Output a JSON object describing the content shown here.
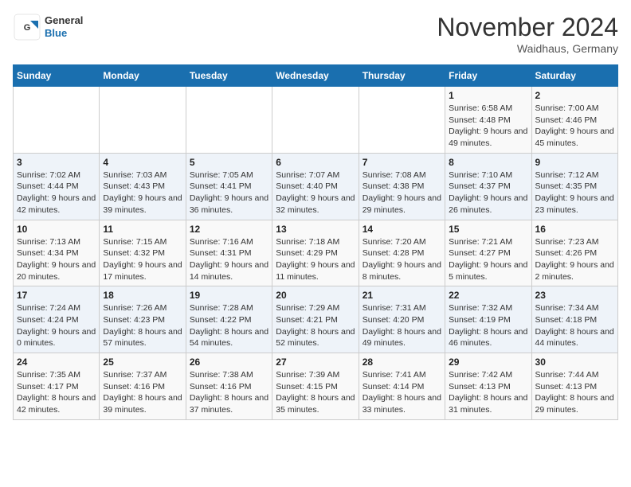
{
  "logo": {
    "text_general": "General",
    "text_blue": "Blue"
  },
  "header": {
    "month_title": "November 2024",
    "location": "Waidhaus, Germany"
  },
  "weekdays": [
    "Sunday",
    "Monday",
    "Tuesday",
    "Wednesday",
    "Thursday",
    "Friday",
    "Saturday"
  ],
  "weeks": [
    [
      {
        "day": "",
        "info": ""
      },
      {
        "day": "",
        "info": ""
      },
      {
        "day": "",
        "info": ""
      },
      {
        "day": "",
        "info": ""
      },
      {
        "day": "",
        "info": ""
      },
      {
        "day": "1",
        "info": "Sunrise: 6:58 AM\nSunset: 4:48 PM\nDaylight: 9 hours and 49 minutes."
      },
      {
        "day": "2",
        "info": "Sunrise: 7:00 AM\nSunset: 4:46 PM\nDaylight: 9 hours and 45 minutes."
      }
    ],
    [
      {
        "day": "3",
        "info": "Sunrise: 7:02 AM\nSunset: 4:44 PM\nDaylight: 9 hours and 42 minutes."
      },
      {
        "day": "4",
        "info": "Sunrise: 7:03 AM\nSunset: 4:43 PM\nDaylight: 9 hours and 39 minutes."
      },
      {
        "day": "5",
        "info": "Sunrise: 7:05 AM\nSunset: 4:41 PM\nDaylight: 9 hours and 36 minutes."
      },
      {
        "day": "6",
        "info": "Sunrise: 7:07 AM\nSunset: 4:40 PM\nDaylight: 9 hours and 32 minutes."
      },
      {
        "day": "7",
        "info": "Sunrise: 7:08 AM\nSunset: 4:38 PM\nDaylight: 9 hours and 29 minutes."
      },
      {
        "day": "8",
        "info": "Sunrise: 7:10 AM\nSunset: 4:37 PM\nDaylight: 9 hours and 26 minutes."
      },
      {
        "day": "9",
        "info": "Sunrise: 7:12 AM\nSunset: 4:35 PM\nDaylight: 9 hours and 23 minutes."
      }
    ],
    [
      {
        "day": "10",
        "info": "Sunrise: 7:13 AM\nSunset: 4:34 PM\nDaylight: 9 hours and 20 minutes."
      },
      {
        "day": "11",
        "info": "Sunrise: 7:15 AM\nSunset: 4:32 PM\nDaylight: 9 hours and 17 minutes."
      },
      {
        "day": "12",
        "info": "Sunrise: 7:16 AM\nSunset: 4:31 PM\nDaylight: 9 hours and 14 minutes."
      },
      {
        "day": "13",
        "info": "Sunrise: 7:18 AM\nSunset: 4:29 PM\nDaylight: 9 hours and 11 minutes."
      },
      {
        "day": "14",
        "info": "Sunrise: 7:20 AM\nSunset: 4:28 PM\nDaylight: 9 hours and 8 minutes."
      },
      {
        "day": "15",
        "info": "Sunrise: 7:21 AM\nSunset: 4:27 PM\nDaylight: 9 hours and 5 minutes."
      },
      {
        "day": "16",
        "info": "Sunrise: 7:23 AM\nSunset: 4:26 PM\nDaylight: 9 hours and 2 minutes."
      }
    ],
    [
      {
        "day": "17",
        "info": "Sunrise: 7:24 AM\nSunset: 4:24 PM\nDaylight: 9 hours and 0 minutes."
      },
      {
        "day": "18",
        "info": "Sunrise: 7:26 AM\nSunset: 4:23 PM\nDaylight: 8 hours and 57 minutes."
      },
      {
        "day": "19",
        "info": "Sunrise: 7:28 AM\nSunset: 4:22 PM\nDaylight: 8 hours and 54 minutes."
      },
      {
        "day": "20",
        "info": "Sunrise: 7:29 AM\nSunset: 4:21 PM\nDaylight: 8 hours and 52 minutes."
      },
      {
        "day": "21",
        "info": "Sunrise: 7:31 AM\nSunset: 4:20 PM\nDaylight: 8 hours and 49 minutes."
      },
      {
        "day": "22",
        "info": "Sunrise: 7:32 AM\nSunset: 4:19 PM\nDaylight: 8 hours and 46 minutes."
      },
      {
        "day": "23",
        "info": "Sunrise: 7:34 AM\nSunset: 4:18 PM\nDaylight: 8 hours and 44 minutes."
      }
    ],
    [
      {
        "day": "24",
        "info": "Sunrise: 7:35 AM\nSunset: 4:17 PM\nDaylight: 8 hours and 42 minutes."
      },
      {
        "day": "25",
        "info": "Sunrise: 7:37 AM\nSunset: 4:16 PM\nDaylight: 8 hours and 39 minutes."
      },
      {
        "day": "26",
        "info": "Sunrise: 7:38 AM\nSunset: 4:16 PM\nDaylight: 8 hours and 37 minutes."
      },
      {
        "day": "27",
        "info": "Sunrise: 7:39 AM\nSunset: 4:15 PM\nDaylight: 8 hours and 35 minutes."
      },
      {
        "day": "28",
        "info": "Sunrise: 7:41 AM\nSunset: 4:14 PM\nDaylight: 8 hours and 33 minutes."
      },
      {
        "day": "29",
        "info": "Sunrise: 7:42 AM\nSunset: 4:13 PM\nDaylight: 8 hours and 31 minutes."
      },
      {
        "day": "30",
        "info": "Sunrise: 7:44 AM\nSunset: 4:13 PM\nDaylight: 8 hours and 29 minutes."
      }
    ]
  ]
}
